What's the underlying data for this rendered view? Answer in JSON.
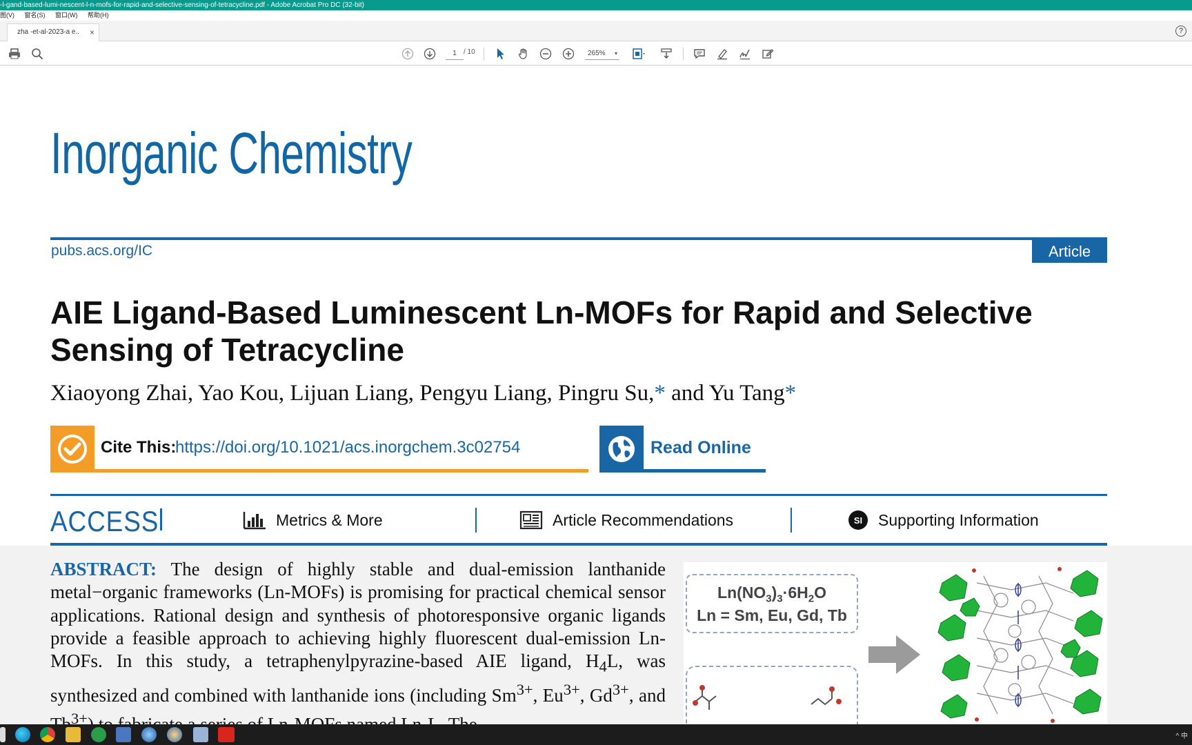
{
  "window": {
    "title": "-l-gand-based-lumi-nescent-l-n-mofs-for-rapid-and-selective-sensing-of-tetracycline.pdf - Adobe Acrobat Pro DC (32-bit)",
    "menu": [
      "图(V)",
      "窗名(S)",
      "窗口(W)",
      "帮助(H)"
    ]
  },
  "tab": {
    "label": "zha -et-al-2023-a e..",
    "close": "×"
  },
  "toolbar": {
    "page_current": "1",
    "page_total": "/ 10",
    "zoom": "265%",
    "icons": [
      "print-icon",
      "search-icon",
      "page-up-icon",
      "page-down-icon",
      "select-icon",
      "hand-icon",
      "zoom-out-icon",
      "zoom-in-icon",
      "fit-page-icon",
      "scroll-mode-icon",
      "comment-icon",
      "highlight-icon",
      "sign-icon",
      "edit-icon"
    ]
  },
  "help": "?",
  "paper": {
    "journal": "Inorganic Chemistry",
    "site": "pubs.acs.org/IC",
    "badge": "Article",
    "title": "AIE Ligand-Based Luminescent Ln-MOFs for Rapid and Selective Sensing of Tetracycline",
    "authors": "Xiaoyong Zhai, Yao Kou, Lijuan Liang, Pengyu Liang, Pingru Su,",
    "authors_and": " and Yu Tang",
    "star": "*",
    "cite_label": "Cite This:",
    "cite_link": "https://doi.org/10.1021/acs.inorgchem.3c02754",
    "read_online": "Read Online",
    "access": "ACCESS",
    "metrics": "Metrics & More",
    "recommendations": "Article Recommendations",
    "supporting": "Supporting Information",
    "si_icon": "SI",
    "abstract_label": "ABSTRACT:",
    "reagent_line1": "Ln(NO3)3·6H2O",
    "reagent_line2": "Ln = Sm, Eu, Gd, Tb"
  },
  "tray": "^ 中"
}
